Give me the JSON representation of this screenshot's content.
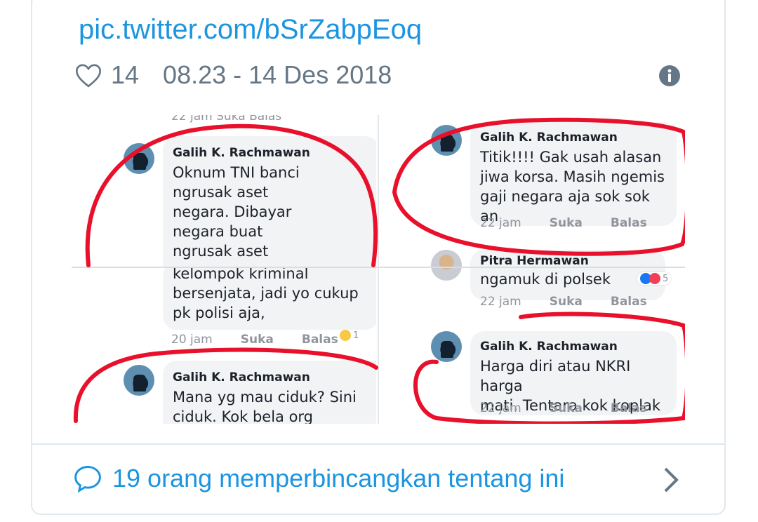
{
  "tweet": {
    "link_text": "pic.twitter.com/bSrZabpEoq",
    "likes": "14",
    "timestamp": "08.23 - 14 Des 2018",
    "discussion": "19 orang memperbincangkan tentang ini"
  },
  "photo": {
    "panels": [
      {
        "top_fragment": "22 jam   Suka   Balas",
        "name": "Galih K. Rachmawan",
        "text": "Oknum TNI banci\nngrusak aset\nnegara. Dibayar\nnegara buat\nngrusak aset",
        "text_cont": "kelompok kriminal\nbersenjata, jadi yo cukup\npk polisi aja,",
        "time": "20 jam",
        "like": "Suka",
        "reply": "Balas",
        "reaction_count": "1"
      },
      {
        "name": "Galih K. Rachmawan",
        "text": "Titik!!!! Gak usah alasan\njiwa korsa. Masih ngemis\ngaji negara aja sok sok an",
        "time": "22 jam",
        "like": "Suka",
        "reply": "Balas"
      },
      {
        "name": "Pitra Hermawan",
        "text": "ngamuk di polsek",
        "time": "22 jam",
        "like": "Suka",
        "reply": "Balas",
        "reaction_count": "5"
      },
      {
        "name": "Galih K. Rachmawan",
        "text": "Harga diri atau NKRI harga\nmati. Tentara kok koplak",
        "time": "22 jam",
        "like": "Suka",
        "reply": "Balas"
      },
      {
        "name": "Galih K. Rachmawan",
        "text": "Mana yg mau ciduk? Sini\nciduk. Kok bela org"
      }
    ]
  },
  "colors": {
    "link": "#1b95e0",
    "meta": "#657786",
    "annotation": "#e8102a"
  },
  "icons": [
    "heart-icon",
    "info-icon",
    "comment-icon",
    "chevron-right-icon"
  ]
}
